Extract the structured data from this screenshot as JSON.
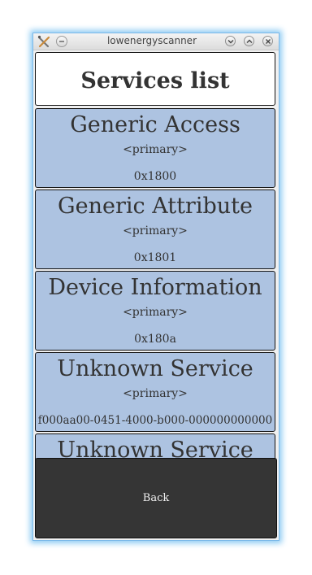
{
  "window": {
    "title": "lowenergyscanner"
  },
  "header": {
    "title": "Services list"
  },
  "services": [
    {
      "name": "Generic Access",
      "type": "<primary>",
      "uuid": "0x1800"
    },
    {
      "name": "Generic Attribute",
      "type": "<primary>",
      "uuid": "0x1801"
    },
    {
      "name": "Device Information",
      "type": "<primary>",
      "uuid": "0x180a"
    },
    {
      "name": "Unknown Service",
      "type": "<primary>",
      "uuid": "f000aa00-0451-4000-b000-000000000000"
    },
    {
      "name": "Unknown Service",
      "type": "",
      "uuid": ""
    }
  ],
  "footer": {
    "back_label": "Back"
  },
  "colors": {
    "service_bg": "#adc3e1",
    "back_bg": "#353535",
    "window_glow": "#8ecbf3"
  }
}
